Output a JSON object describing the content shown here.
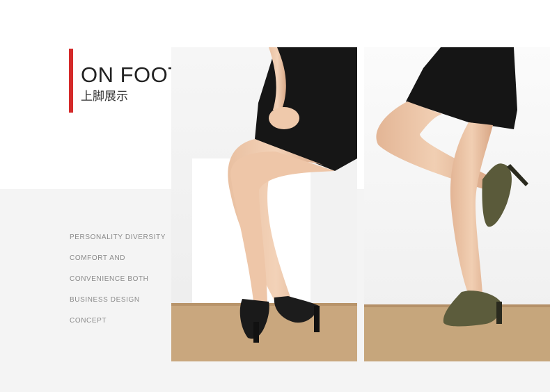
{
  "header": {
    "title": "ON FOOT",
    "subtitle": "上脚展示"
  },
  "description": {
    "lines": [
      "PERSONALITY DIVERSITY",
      "COMFORT AND",
      "CONVENIENCE BOTH",
      "BUSINESS DESIGN",
      "CONCEPT"
    ]
  },
  "colors": {
    "accent_bar": "#d42a2a",
    "floor": "#c9a77e",
    "shoe_left": "#1a1a1a",
    "shoe_right": "#5a5a3a"
  }
}
